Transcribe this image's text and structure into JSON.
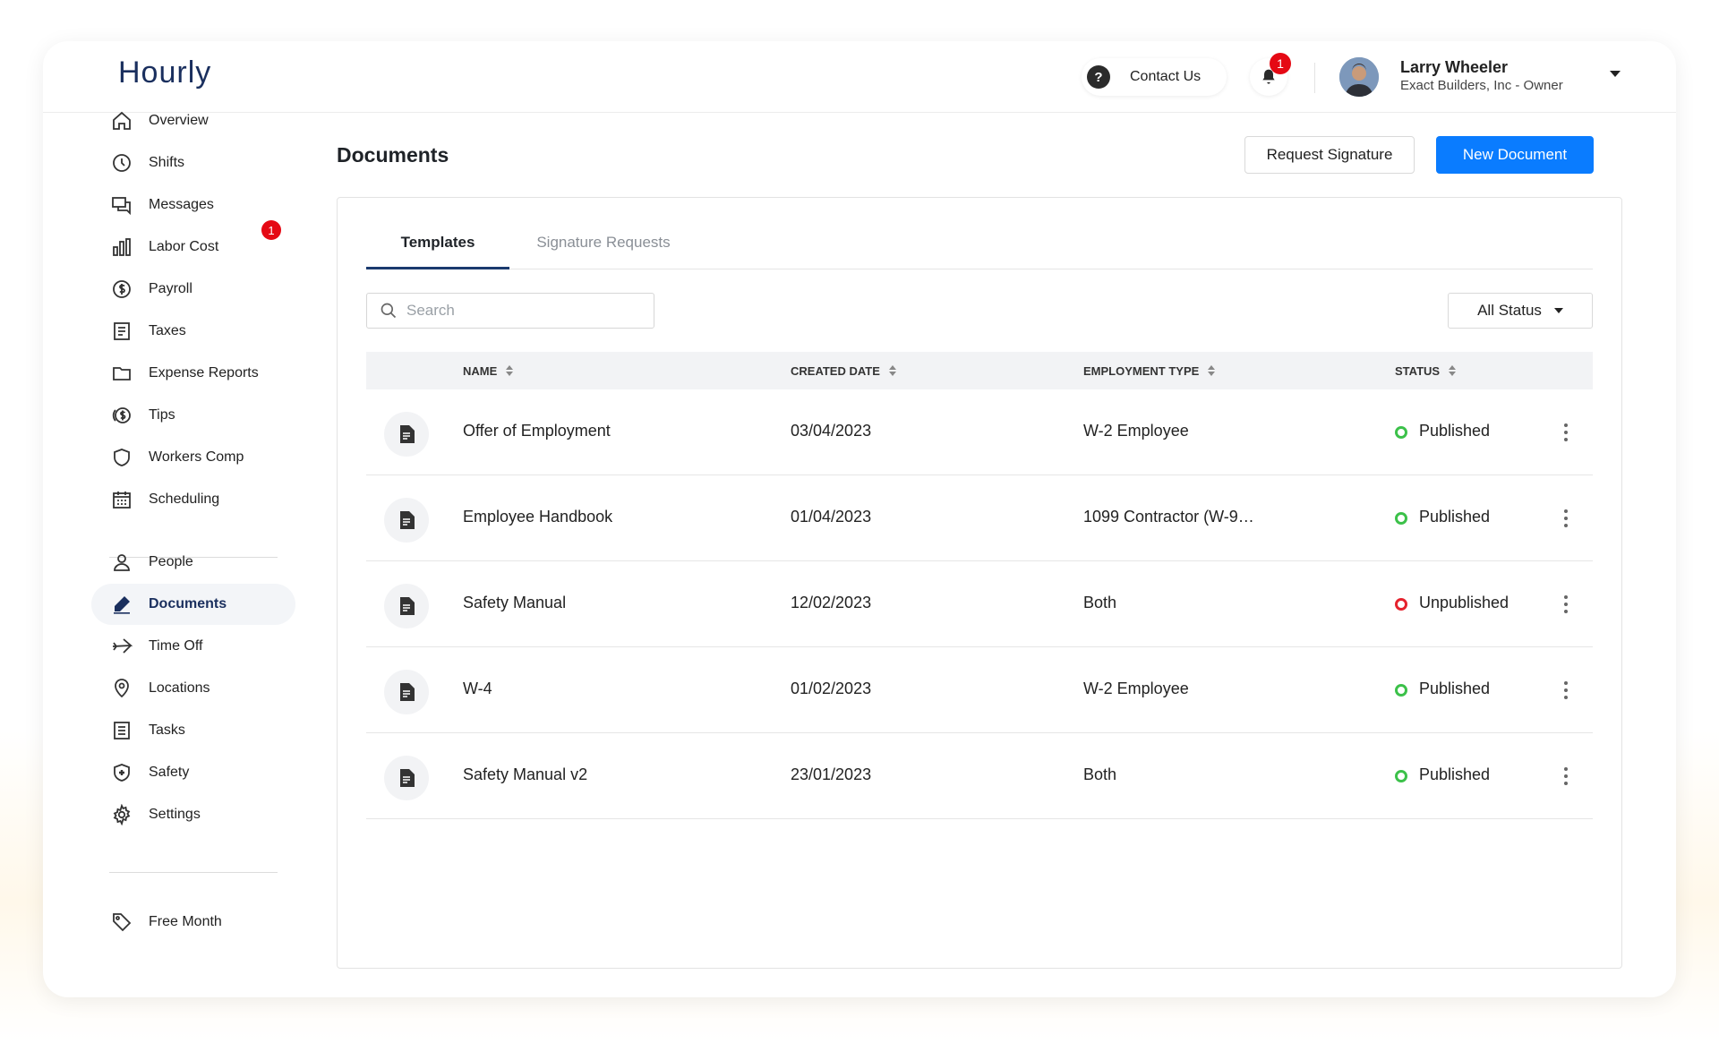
{
  "app": {
    "logo": "Hourly"
  },
  "header": {
    "contact_label": "Contact Us",
    "notification_count": "1",
    "user_name": "Larry Wheeler",
    "user_role": "Exact Builders, Inc - Owner"
  },
  "sidebar": {
    "items": [
      {
        "label": "Overview",
        "icon": "home-icon"
      },
      {
        "label": "Shifts",
        "icon": "clock-icon"
      },
      {
        "label": "Messages",
        "icon": "messages-icon",
        "badge": "1"
      },
      {
        "label": "Labor Cost",
        "icon": "bar-chart-icon"
      },
      {
        "label": "Payroll",
        "icon": "dollar-circle-icon"
      },
      {
        "label": "Taxes",
        "icon": "document-lines-icon"
      },
      {
        "label": "Expense Reports",
        "icon": "folder-icon"
      },
      {
        "label": "Tips",
        "icon": "tips-dollar-icon"
      },
      {
        "label": "Workers Comp",
        "icon": "shield-icon"
      },
      {
        "label": "Scheduling",
        "icon": "calendar-icon"
      },
      {
        "label": "People",
        "icon": "person-icon"
      },
      {
        "label": "Documents",
        "icon": "pen-icon",
        "active": true
      },
      {
        "label": "Time Off",
        "icon": "plane-icon"
      },
      {
        "label": "Locations",
        "icon": "location-pin-icon"
      },
      {
        "label": "Tasks",
        "icon": "tasks-icon"
      },
      {
        "label": "Safety",
        "icon": "safety-shield-icon"
      },
      {
        "label": "Settings",
        "icon": "gear-icon"
      },
      {
        "label": "Free Month",
        "icon": "tag-icon"
      }
    ]
  },
  "main": {
    "title": "Documents",
    "request_signature_label": "Request Signature",
    "new_document_label": "New Document",
    "tabs": [
      {
        "label": "Templates",
        "active": true
      },
      {
        "label": "Signature Requests",
        "active": false
      }
    ],
    "search": {
      "placeholder": "Search",
      "value": ""
    },
    "status_filter": {
      "selected": "All Status"
    },
    "table": {
      "columns": [
        "NAME",
        "CREATED DATE",
        "EMPLOYMENT TYPE",
        "STATUS"
      ],
      "rows": [
        {
          "name": "Offer of Employment",
          "created": "03/04/2023",
          "type": "W-2 Employee",
          "status": "Published"
        },
        {
          "name": "Employee Handbook",
          "created": "01/04/2023",
          "type": "1099 Contractor (W-9…",
          "status": "Published"
        },
        {
          "name": "Safety Manual",
          "created": "12/02/2023",
          "type": "Both",
          "status": "Unpublished"
        },
        {
          "name": "W-4",
          "created": "01/02/2023",
          "type": "W-2 Employee",
          "status": "Published"
        },
        {
          "name": "Safety Manual v2",
          "created": "23/01/2023",
          "type": "Both",
          "status": "Published"
        }
      ]
    }
  },
  "colors": {
    "primary": "#0a7cff",
    "brand_navy": "#1a2f5e",
    "published": "#3cc14a",
    "unpublished": "#e5232e",
    "badge": "#e50914"
  }
}
